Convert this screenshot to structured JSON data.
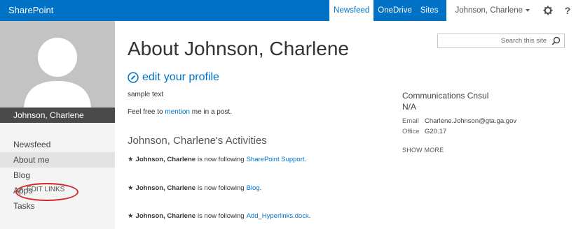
{
  "suite_bar": {
    "brand": "SharePoint",
    "links": [
      "Newsfeed",
      "OneDrive",
      "Sites"
    ],
    "user_name": "Johnson, Charlene",
    "help_glyph": "?"
  },
  "left_panel": {
    "profile_name": "Johnson, Charlene",
    "nav": [
      "Newsfeed",
      "About me",
      "Blog",
      "Apps",
      "Tasks"
    ],
    "edit_links_label": "EDIT LINKS"
  },
  "main": {
    "title": "About Johnson, Charlene",
    "edit_word": "edit",
    "edit_rest": "your profile",
    "about_text": "sample text",
    "mention_prefix": "Feel free to",
    "mention_link": "mention",
    "mention_suffix": "me in a post.",
    "activities_heading": "Johnson, Charlene's Activities",
    "activities": [
      {
        "actor": "Johnson, Charlene",
        "verb": "is now following",
        "target": "SharePoint Support",
        "end": "."
      },
      {
        "actor": "Johnson, Charlene",
        "verb": "is now following",
        "target": "Blog",
        "end": "."
      },
      {
        "actor": "Johnson, Charlene",
        "verb": "is now following",
        "target": "Add_Hyperlinks.docx",
        "end": "."
      }
    ]
  },
  "right": {
    "search_placeholder": "Search this site",
    "department": "Communications Cnsul",
    "title_value": "N/A",
    "email_label": "Email",
    "email_value": "Charlene.Johnson@gta.ga.gov",
    "office_label": "Office",
    "office_value": "G20.17",
    "show_more": "SHOW MORE"
  },
  "colors": {
    "suite_bar": "#0072c6",
    "link": "#0072c6",
    "edit_links_highlight": "#d4252b"
  }
}
